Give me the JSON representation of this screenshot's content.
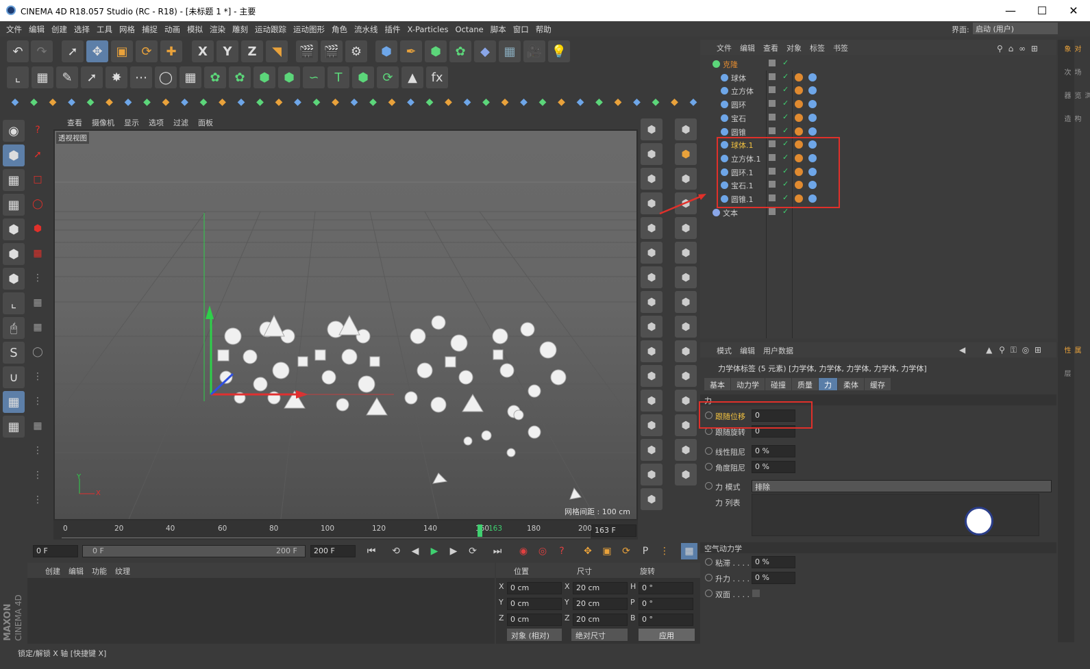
{
  "window": {
    "title": "CINEMA 4D R18.057 Studio (RC - R18) - [未标题 1 *] - 主要"
  },
  "menubar": {
    "items": [
      "文件",
      "编辑",
      "创建",
      "选择",
      "工具",
      "网格",
      "捕捉",
      "动画",
      "模拟",
      "渲染",
      "雕刻",
      "运动跟踪",
      "运动图形",
      "角色",
      "流水线",
      "插件",
      "X-Particles",
      "Octane",
      "脚本",
      "窗口",
      "帮助"
    ],
    "layout_label": "界面:",
    "layout_value": "启动 (用户)"
  },
  "viewport": {
    "menu": [
      "查看",
      "摄像机",
      "显示",
      "选项",
      "过滤",
      "面板"
    ],
    "label": "透视视图",
    "grid_text": "网格间距 : 100 cm",
    "axis_y": "Y",
    "axis_x": "X"
  },
  "timeline": {
    "ticks": [
      "0",
      "20",
      "40",
      "60",
      "80",
      "100",
      "120",
      "140",
      "160",
      "163",
      "180",
      "200"
    ],
    "current": "163 F",
    "start": "0 F",
    "slider_start": "0 F",
    "slider_end": "200 F",
    "end": "200 F",
    "current_frame": 163,
    "max_frame": 200
  },
  "materials": {
    "menu": [
      "创建",
      "编辑",
      "功能",
      "纹理"
    ]
  },
  "coords": {
    "headers": [
      "位置",
      "尺寸",
      "旋转"
    ],
    "rows": [
      {
        "a": "X",
        "pos": "0 cm",
        "b": "X",
        "size": "20 cm",
        "c": "H",
        "rot": "0 °"
      },
      {
        "a": "Y",
        "pos": "0 cm",
        "b": "Y",
        "size": "20 cm",
        "c": "P",
        "rot": "0 °"
      },
      {
        "a": "Z",
        "pos": "0 cm",
        "b": "Z",
        "size": "20 cm",
        "c": "B",
        "rot": "0 °"
      }
    ],
    "mode1": "对象 (相对)",
    "mode2": "绝对尺寸",
    "apply": "应用"
  },
  "objects": {
    "menu": [
      "文件",
      "编辑",
      "查看",
      "对象",
      "标签",
      "书签"
    ],
    "items": [
      {
        "name": "克隆",
        "color": "#e08a30"
      },
      {
        "name": "球体",
        "color": "#cfcfcf"
      },
      {
        "name": "立方体",
        "color": "#cfcfcf"
      },
      {
        "name": "圆环",
        "color": "#cfcfcf"
      },
      {
        "name": "宝石",
        "color": "#cfcfcf"
      },
      {
        "name": "圆锥",
        "color": "#cfcfcf"
      },
      {
        "name": "球体.1",
        "color": "#f0c040"
      },
      {
        "name": "立方体.1",
        "color": "#cfcfcf"
      },
      {
        "name": "圆环.1",
        "color": "#cfcfcf"
      },
      {
        "name": "宝石.1",
        "color": "#cfcfcf"
      },
      {
        "name": "圆锥.1",
        "color": "#cfcfcf"
      },
      {
        "name": "文本",
        "color": "#cfcfcf"
      }
    ]
  },
  "attributes": {
    "menu": [
      "模式",
      "编辑",
      "用户数据"
    ],
    "title": "力学体标签 (5 元素) [力学体, 力学体, 力学体, 力学体, 力学体]",
    "tabs": [
      "基本",
      "动力学",
      "碰撞",
      "质量",
      "力",
      "柔体",
      "缓存"
    ],
    "section_force": "力",
    "props": [
      {
        "label": "跟随位移",
        "value": "0"
      },
      {
        "label": "跟随旋转",
        "value": "0"
      },
      {
        "label": "线性阻尼",
        "value": "0 %"
      },
      {
        "label": "角度阻尼",
        "value": "0 %"
      },
      {
        "label": "力 模式",
        "value": "排除"
      },
      {
        "label": "力 列表",
        "value": ""
      }
    ],
    "section_aero": "空气动力学",
    "aero": [
      {
        "label": "粘滞 . . . .",
        "value": "0 %"
      },
      {
        "label": "升力 . . . .",
        "value": "0 %"
      },
      {
        "label": "双面 . . . .",
        "value": ""
      }
    ]
  },
  "right_tabs": [
    "对象",
    "场次",
    "内容浏览器",
    "构造"
  ],
  "right_tabs2": [
    "属性",
    "层"
  ],
  "statusbar": {
    "text": "锁定/解锁 X 轴 [快捷键 X]"
  },
  "brand": {
    "line1": "MAXON",
    "line2": "CINEMA 4D"
  },
  "colors": {
    "accent": "#5a7ea8",
    "highlight": "#e0302a",
    "orange": "#e08a30"
  }
}
